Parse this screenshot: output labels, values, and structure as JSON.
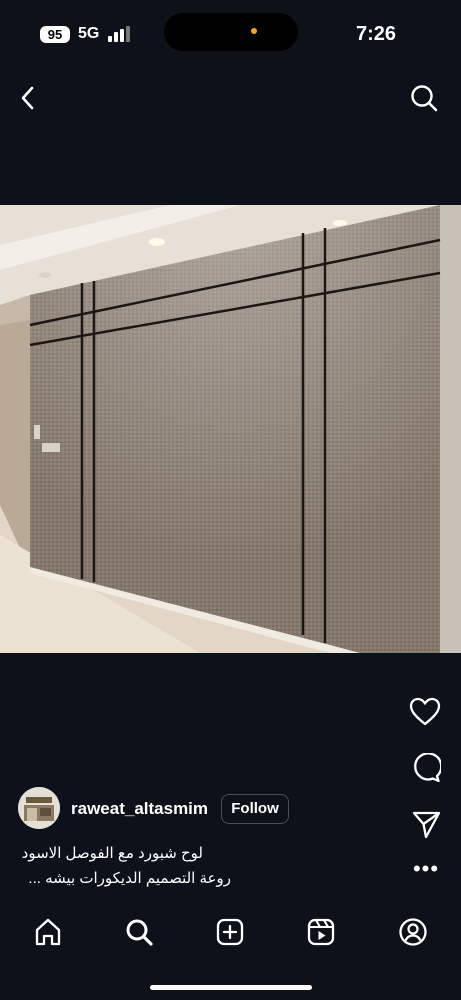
{
  "status_bar": {
    "battery": "95",
    "network": "5G",
    "time": "7:26",
    "signal_icon": "signal-bars-icon"
  },
  "top_nav": {
    "back_icon": "chevron-left-icon",
    "search_icon": "search-icon"
  },
  "post": {
    "image": "photo of a hallway wall with fabric-textured panels separated by black strips",
    "actions": [
      "heart-icon",
      "comment-icon",
      "send-icon",
      "more-icon"
    ],
    "more_label": "•••",
    "username": "raweat_altasmim",
    "follow_label": "Follow",
    "caption_line1": "لوح شبورد مع الفوصل الاسود",
    "caption_line2": "روعة التصميم الديكورات  بيشه ..."
  },
  "bottom_nav": [
    "home-icon",
    "search-icon",
    "create-icon",
    "reels-icon",
    "profile-icon"
  ],
  "colors": {
    "background": "#0c111a",
    "text": "#ffffff",
    "island_dot": "#f5a623"
  }
}
